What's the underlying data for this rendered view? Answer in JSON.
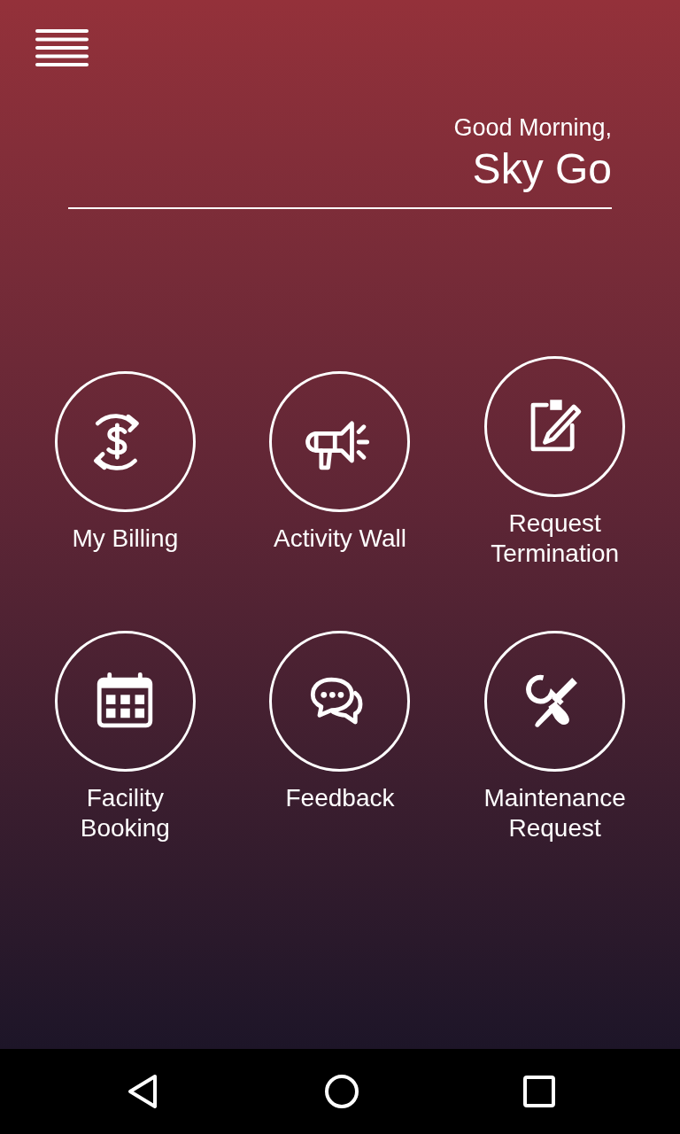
{
  "greeting": "Good Morning,",
  "user_name": "Sky Go",
  "tiles": [
    {
      "kind": "billing",
      "label": "My Billing"
    },
    {
      "kind": "megaphone",
      "label": "Activity Wall"
    },
    {
      "kind": "edit",
      "label": "Request\nTermination"
    },
    {
      "kind": "calendar",
      "label": "Facility\nBooking"
    },
    {
      "kind": "chat",
      "label": "Feedback"
    },
    {
      "kind": "tools",
      "label": "Maintenance\nRequest"
    }
  ]
}
